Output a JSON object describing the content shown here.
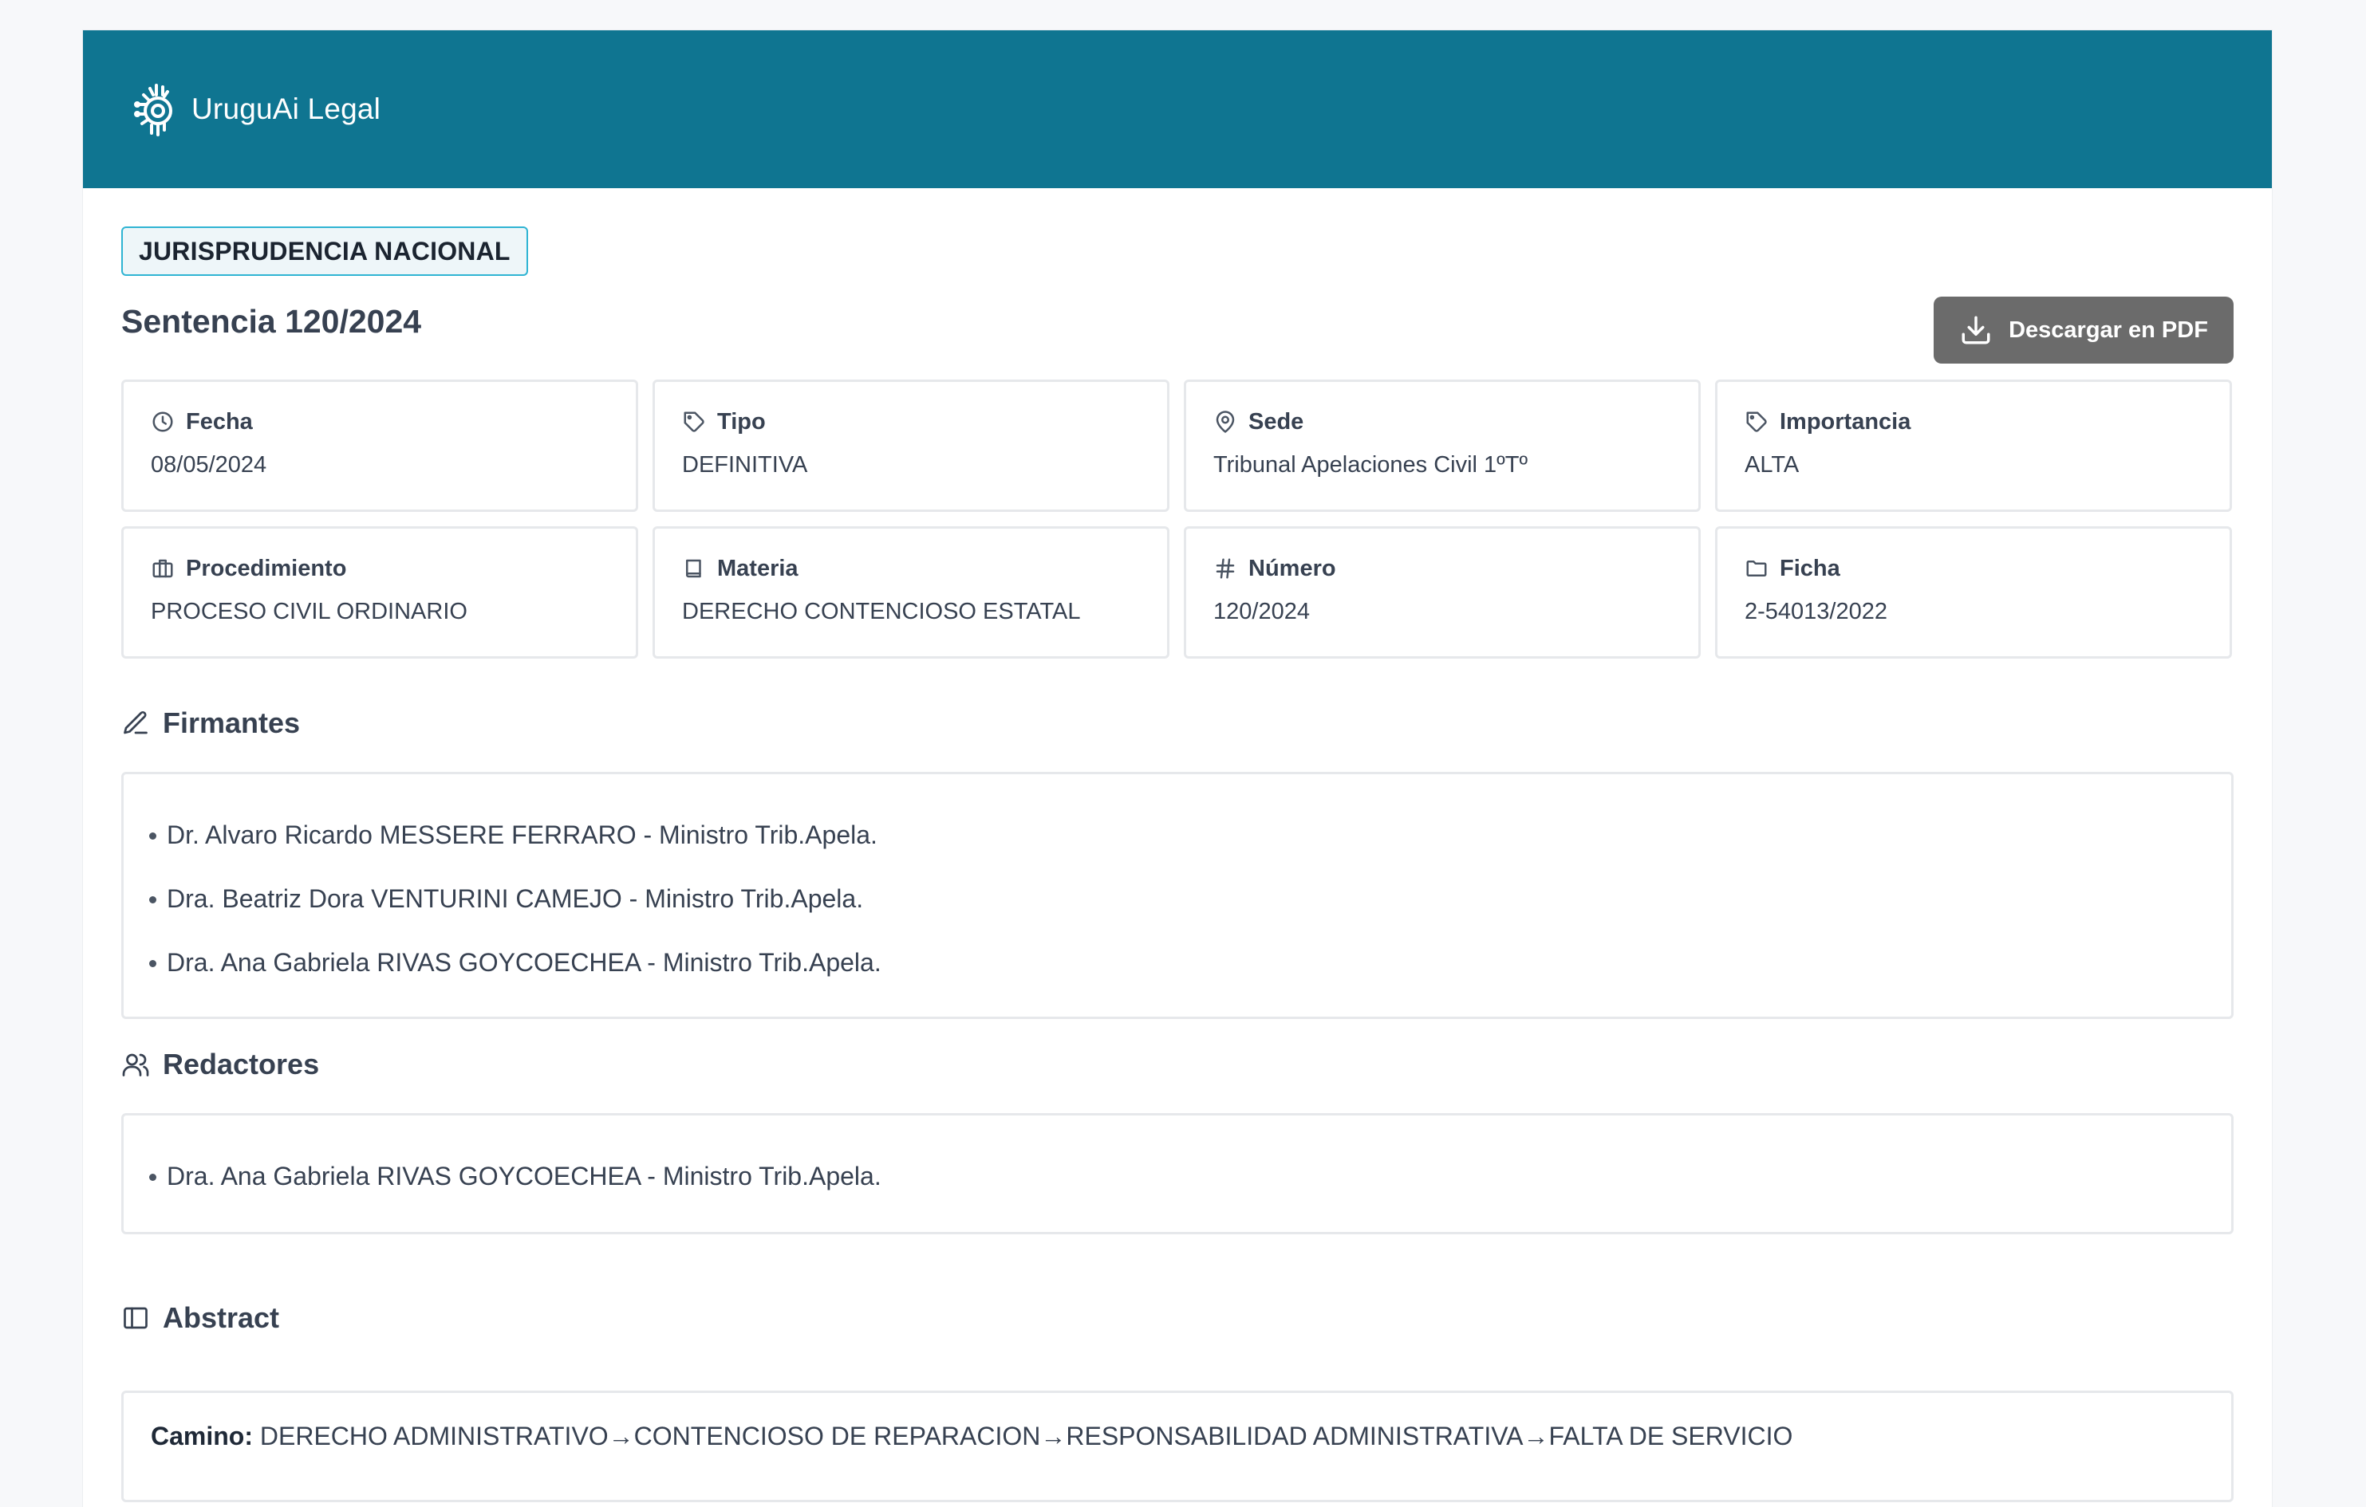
{
  "app": {
    "name": "UruguAi Legal",
    "logo_icon": "brain-circuit-icon",
    "header_color": "#0f7591"
  },
  "document": {
    "badge": "JURISPRUDENCIA NACIONAL",
    "title": "Sentencia 120/2024",
    "download_label": "Descargar en PDF",
    "download_icon": "download-icon"
  },
  "fields": [
    {
      "label": "Fecha",
      "value": "08/05/2024",
      "icon": "clock-icon"
    },
    {
      "label": "Tipo",
      "value": "DEFINITIVA",
      "icon": "tag-icon"
    },
    {
      "label": "Sede",
      "value": "Tribunal Apelaciones Civil 1ºTº",
      "icon": "map-pin-icon"
    },
    {
      "label": "Importancia",
      "value": "ALTA",
      "icon": "tag-icon"
    },
    {
      "label": "Procedimiento",
      "value": "PROCESO CIVIL ORDINARIO",
      "icon": "briefcase-icon"
    },
    {
      "label": "Materia",
      "value": "DERECHO CONTENCIOSO ESTATAL",
      "icon": "book-icon"
    },
    {
      "label": "Número",
      "value": "120/2024",
      "icon": "hash-icon"
    },
    {
      "label": "Ficha",
      "value": "2-54013/2022",
      "icon": "folder-icon"
    }
  ],
  "firmantes": {
    "title": "Firmantes",
    "icon": "pen-icon",
    "items": [
      "Dr. Alvaro Ricardo MESSERE FERRARO - Ministro Trib.Apela.",
      "Dra. Beatriz Dora VENTURINI CAMEJO - Ministro Trib.Apela.",
      "Dra. Ana Gabriela RIVAS GOYCOECHEA - Ministro Trib.Apela."
    ]
  },
  "redactores": {
    "title": "Redactores",
    "icon": "users-icon",
    "items": [
      "Dra. Ana Gabriela RIVAS GOYCOECHEA - Ministro Trib.Apela."
    ]
  },
  "abstract": {
    "title": "Abstract",
    "icon": "book-open-icon",
    "camino_label": "Camino:",
    "camino_value": "DERECHO ADMINISTRATIVO→CONTENCIOSO DE REPARACION→RESPONSABILIDAD ADMINISTRATIVA→FALTA DE SERVICIO"
  }
}
